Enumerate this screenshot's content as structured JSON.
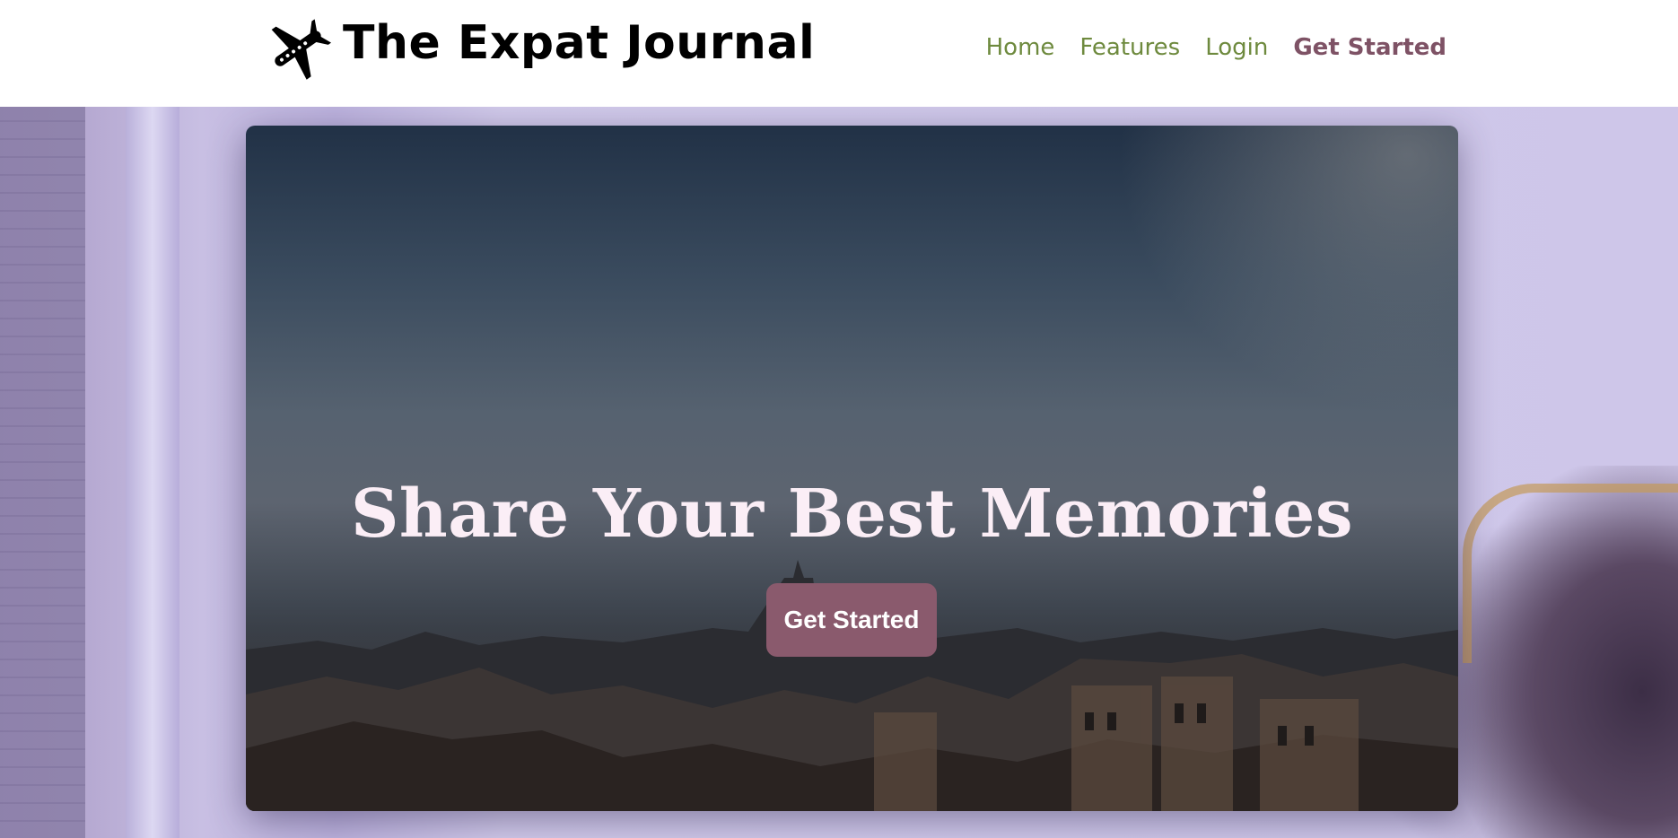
{
  "header": {
    "brand_title": "The Expat Journal",
    "logo_icon": "airplane-icon",
    "nav": [
      {
        "label": "Home"
      },
      {
        "label": "Features"
      },
      {
        "label": "Login"
      }
    ],
    "cta_label": "Get Started"
  },
  "hero": {
    "title": "Share Your Best Memories",
    "button_label": "Get Started"
  },
  "colors": {
    "nav_link": "#6e8a3e",
    "accent": "#8a5a6d",
    "cta_text": "#7e5265",
    "hero_title": "#fbeef6",
    "background_lavender": "#c9c2e4"
  }
}
